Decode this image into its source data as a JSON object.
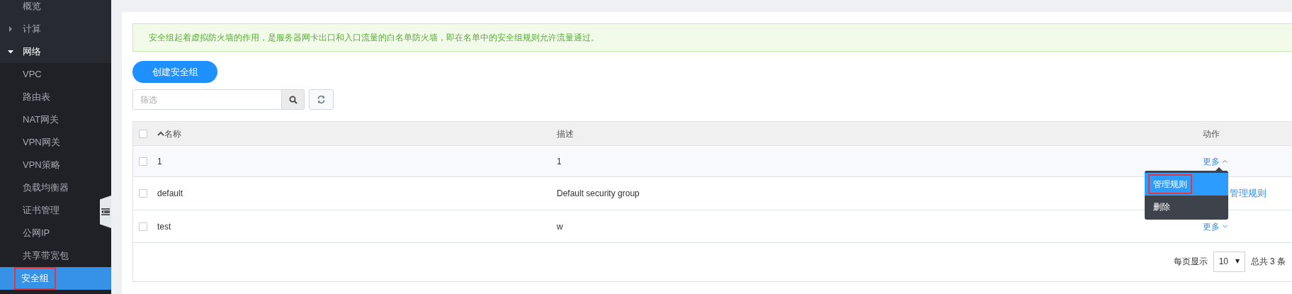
{
  "sidebar": {
    "items": [
      {
        "label": "概览",
        "kind": "top",
        "selected": false
      },
      {
        "label": "计算",
        "kind": "top",
        "expanded": false,
        "selected": false
      },
      {
        "label": "网络",
        "kind": "top",
        "expanded": true,
        "selected": false,
        "children": [
          {
            "label": "VPC",
            "selected": false
          },
          {
            "label": "路由表",
            "selected": false
          },
          {
            "label": "NAT网关",
            "selected": false
          },
          {
            "label": "VPN网关",
            "selected": false
          },
          {
            "label": "VPN策略",
            "selected": false
          },
          {
            "label": "负载均衡器",
            "selected": false
          },
          {
            "label": "证书管理",
            "selected": false
          },
          {
            "label": "公网IP",
            "selected": false
          },
          {
            "label": "共享带宽包",
            "selected": false
          },
          {
            "label": "安全组",
            "selected": true,
            "annotated": true
          }
        ]
      }
    ]
  },
  "notice": "安全组起着虚拟防火墙的作用，是服务器网卡出口和入口流量的白名单防火墙，即在名单中的安全组规则允许流量通过。",
  "create_button": "创建安全组",
  "filter": {
    "placeholder": "筛选"
  },
  "table": {
    "header_checked": false,
    "columns": [
      "名称",
      "描述",
      "动作"
    ],
    "rows": [
      {
        "name": "1",
        "description": "1",
        "action": "更多",
        "expanded": true,
        "checked": false
      },
      {
        "name": "default",
        "description": "Default security group",
        "action": "管理规则",
        "checked": false
      },
      {
        "name": "test",
        "description": "w",
        "action": "更多",
        "expanded": false,
        "checked": false
      }
    ]
  },
  "dropdown": {
    "items": [
      {
        "label": "管理规则",
        "selected": true,
        "annotated": true
      },
      {
        "label": "删除",
        "selected": false,
        "annotated": false
      }
    ]
  },
  "pagination": {
    "per_page_label": "每页显示",
    "per_page": "10",
    "total": "总共 3 条"
  }
}
